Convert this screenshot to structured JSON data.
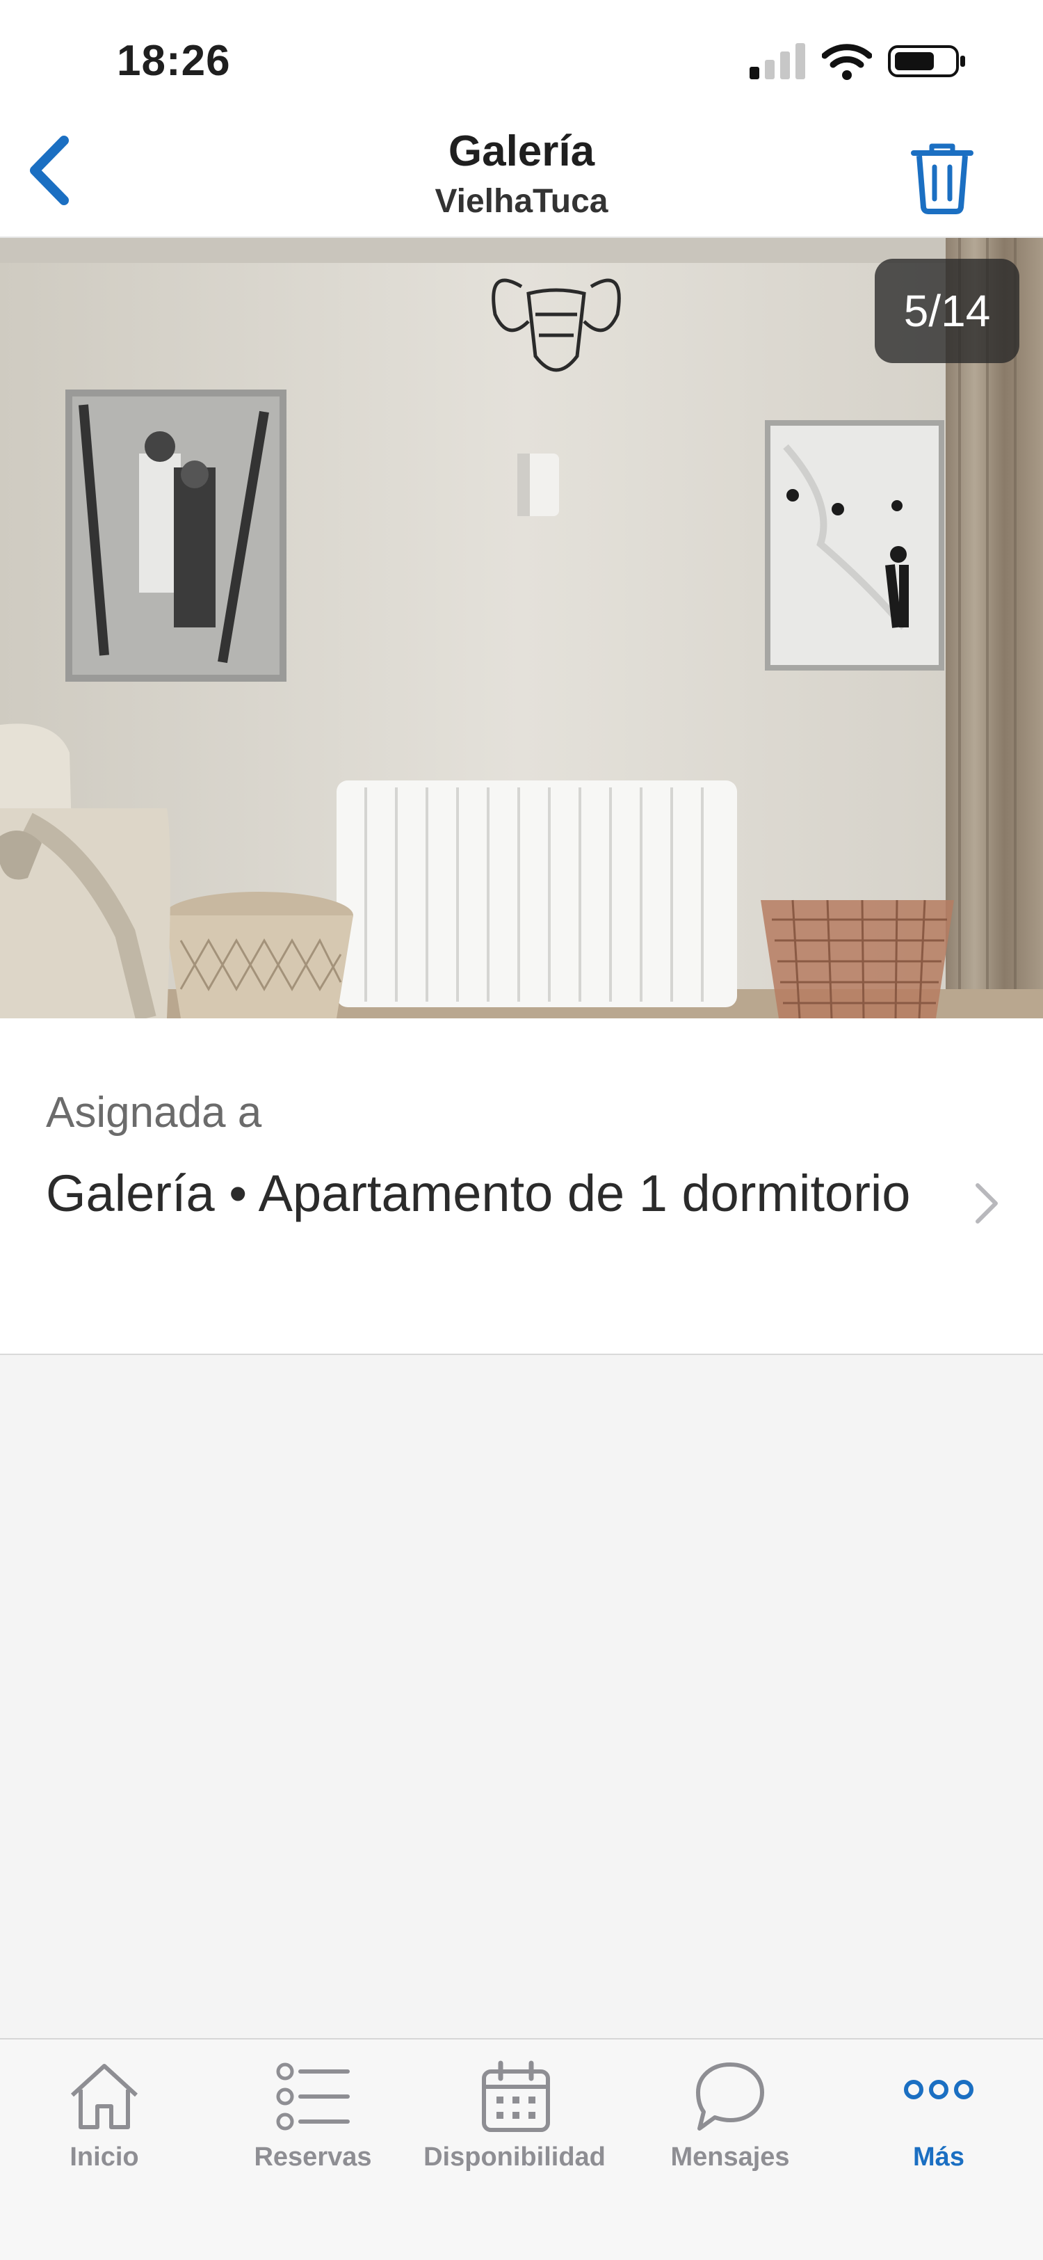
{
  "status_bar": {
    "time": "18:26"
  },
  "nav": {
    "title": "Galería",
    "subtitle": "VielhaTuca"
  },
  "photo": {
    "counter": "5/14"
  },
  "assignment": {
    "label": "Asignada a",
    "value": "Galería • Apartamento de 1 dormitorio"
  },
  "tabs": [
    {
      "label": "Inicio",
      "icon": "home-icon",
      "active": false
    },
    {
      "label": "Reservas",
      "icon": "list-icon",
      "active": false
    },
    {
      "label": "Disponibilidad",
      "icon": "calendar-icon",
      "active": false
    },
    {
      "label": "Mensajes",
      "icon": "chat-bubble-icon",
      "active": false
    },
    {
      "label": "Más",
      "icon": "more-dots-icon",
      "active": true
    }
  ],
  "colors": {
    "accent": "#1b6fc2",
    "inactive": "#8e8e93",
    "background": "#f4f4f4"
  }
}
